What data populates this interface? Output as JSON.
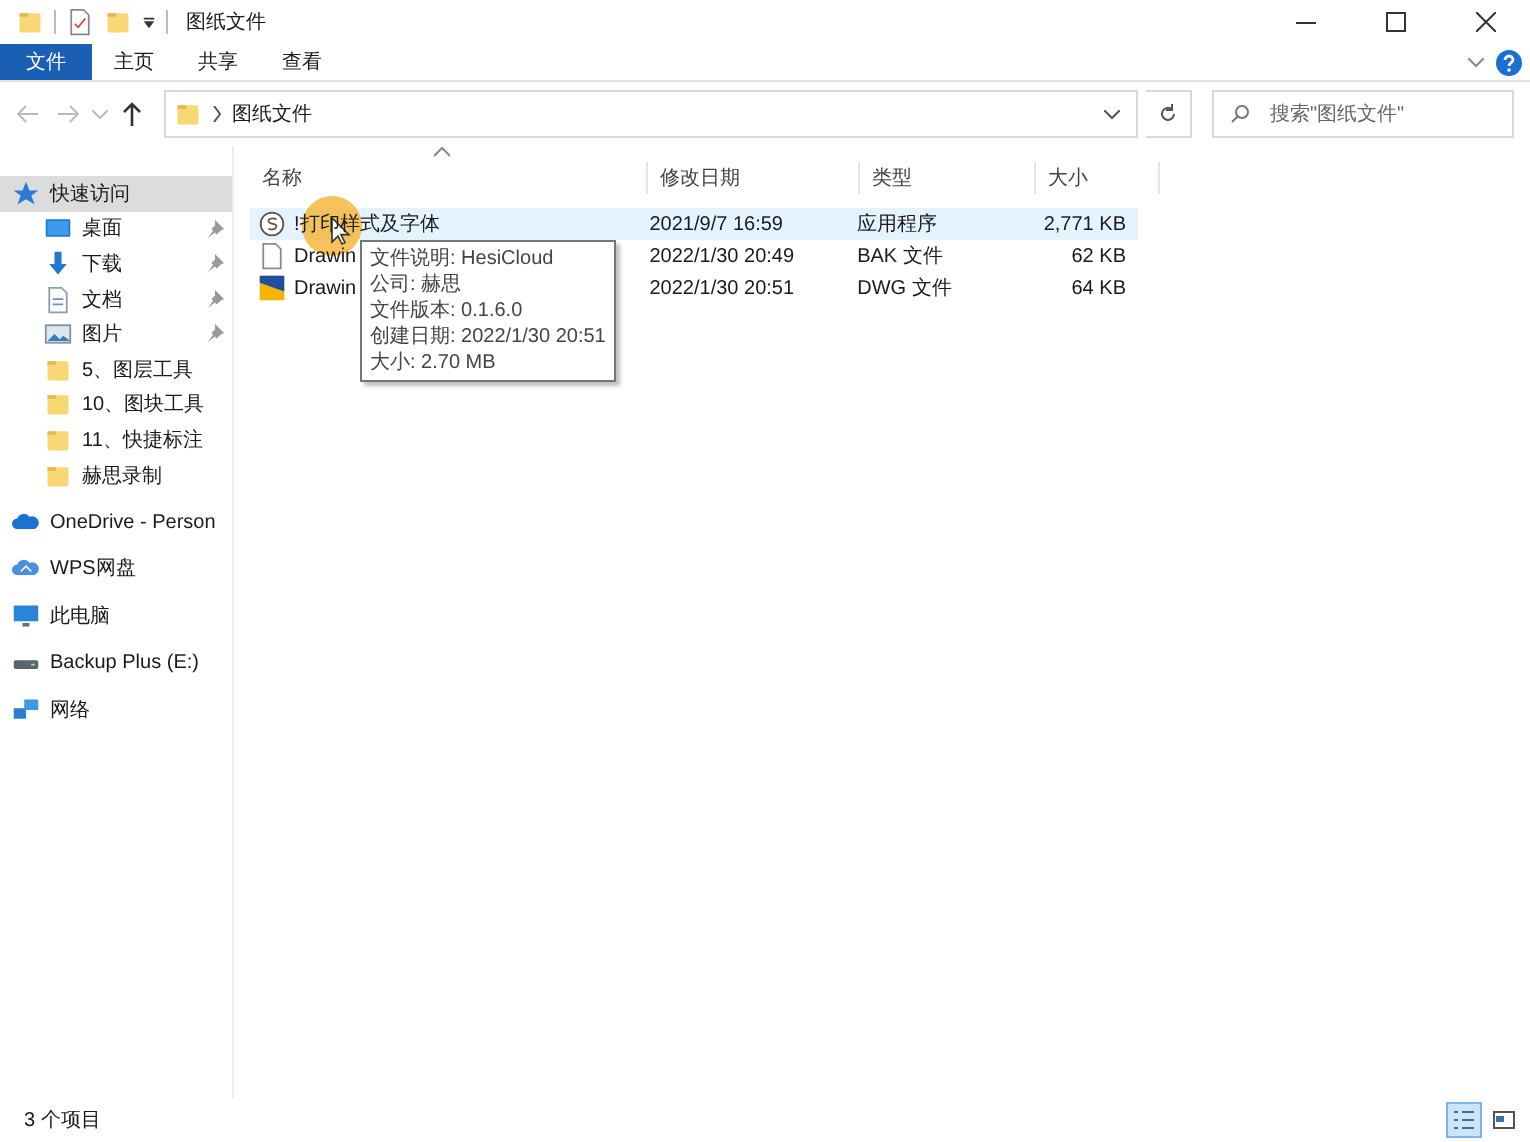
{
  "window": {
    "title": "图纸文件"
  },
  "ribbon_tabs": [
    {
      "label": "文件",
      "selected": true
    },
    {
      "label": "主页",
      "selected": false
    },
    {
      "label": "共享",
      "selected": false
    },
    {
      "label": "查看",
      "selected": false
    }
  ],
  "address": {
    "path": "图纸文件"
  },
  "search": {
    "placeholder": "搜索\"图纸文件\""
  },
  "sidebar": {
    "items": [
      {
        "label": "快速访问",
        "kind": "star",
        "selected": true,
        "pinned": false
      },
      {
        "label": "桌面",
        "kind": "desktop",
        "selected": false,
        "pinned": true
      },
      {
        "label": "下载",
        "kind": "download",
        "selected": false,
        "pinned": true
      },
      {
        "label": "文档",
        "kind": "document",
        "selected": false,
        "pinned": true
      },
      {
        "label": "图片",
        "kind": "picture",
        "selected": false,
        "pinned": true
      },
      {
        "label": "5、图层工具",
        "kind": "folder",
        "selected": false,
        "pinned": false
      },
      {
        "label": "10、图块工具",
        "kind": "folder",
        "selected": false,
        "pinned": false
      },
      {
        "label": "11、快捷标注",
        "kind": "folder",
        "selected": false,
        "pinned": false
      },
      {
        "label": "赫思录制",
        "kind": "folder",
        "selected": false,
        "pinned": false
      },
      {
        "label": "OneDrive - Person",
        "kind": "cloud",
        "selected": false,
        "pinned": false
      },
      {
        "label": "WPS网盘",
        "kind": "wps-cloud",
        "selected": false,
        "pinned": false
      },
      {
        "label": "此电脑",
        "kind": "pc",
        "selected": false,
        "pinned": false
      },
      {
        "label": "Backup Plus (E:)",
        "kind": "drive",
        "selected": false,
        "pinned": false
      },
      {
        "label": "网络",
        "kind": "network",
        "selected": false,
        "pinned": false
      }
    ]
  },
  "table": {
    "columns": [
      "名称",
      "修改日期",
      "类型",
      "大小"
    ],
    "rows": [
      {
        "name": "!打印样式及字体",
        "kind": "app",
        "date": "2021/9/7 16:59",
        "type": "应用程序",
        "size": "2,771 KB",
        "hovered": true
      },
      {
        "name": "Drawin",
        "kind": "file",
        "date": "2022/1/30 20:49",
        "type": "BAK 文件",
        "size": "62 KB",
        "hovered": false
      },
      {
        "name": "Drawin",
        "kind": "dwg",
        "date": "2022/1/30 20:51",
        "type": "DWG 文件",
        "size": "64 KB",
        "hovered": false
      }
    ]
  },
  "tooltip": {
    "lines": [
      "文件说明: HesiCloud",
      "公司: 赫思",
      "文件版本: 0.1.6.0",
      "创建日期: 2022/1/30 20:51",
      "大小: 2.70 MB"
    ]
  },
  "status_bar": {
    "count": "3 个项目",
    "views": [
      {
        "kind": "details",
        "selected": true
      },
      {
        "kind": "tiles",
        "selected": false
      }
    ]
  }
}
